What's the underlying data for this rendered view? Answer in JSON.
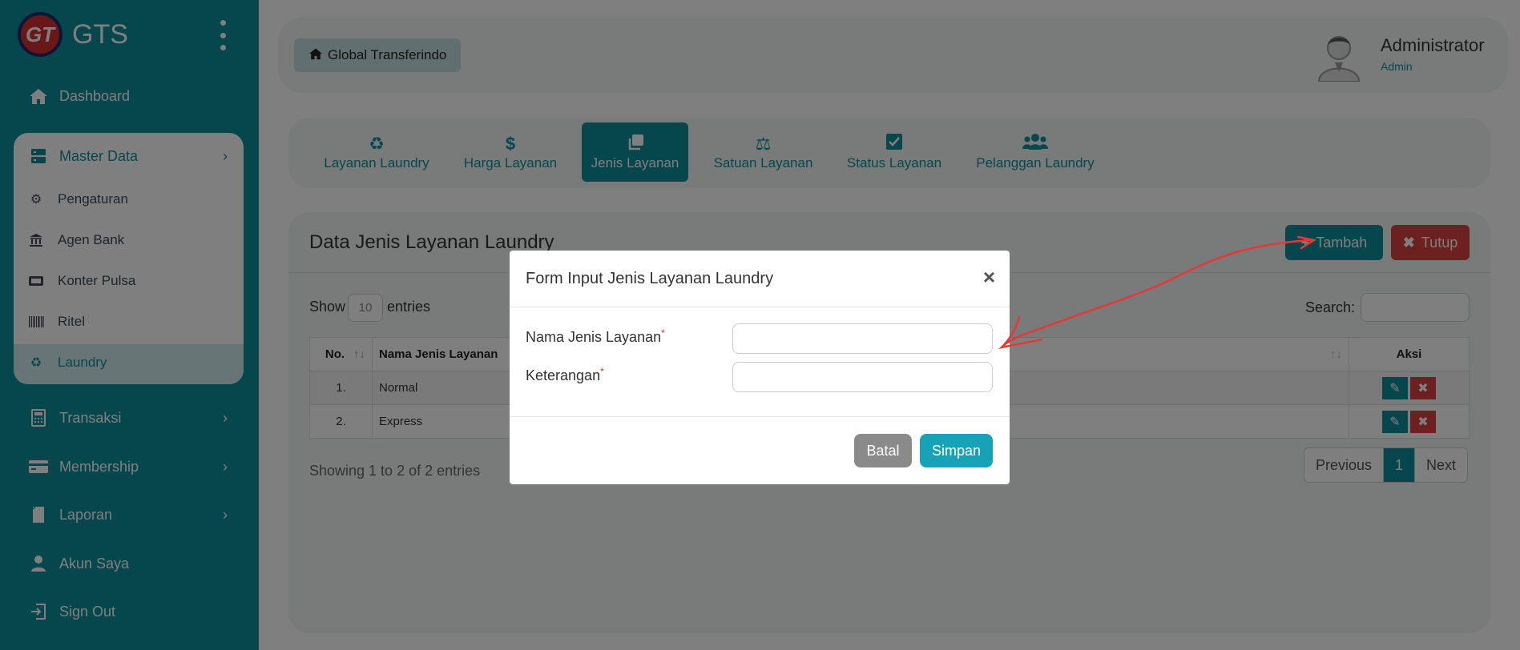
{
  "brand": {
    "logo_text": "GT",
    "name": "GTS"
  },
  "sidebar": {
    "items": [
      {
        "label": "Dashboard",
        "icon": "home-icon"
      },
      {
        "label": "Master Data",
        "icon": "server-icon"
      },
      {
        "label": "Transaksi",
        "icon": "calculator-icon"
      },
      {
        "label": "Membership",
        "icon": "credit-card-icon"
      },
      {
        "label": "Laporan",
        "icon": "book-icon"
      },
      {
        "label": "Akun Saya",
        "icon": "user-icon"
      },
      {
        "label": "Sign Out",
        "icon": "sign-out-icon"
      }
    ],
    "submenu": [
      {
        "label": "Pengaturan",
        "icon": "gear-icon"
      },
      {
        "label": "Agen Bank",
        "icon": "bank-icon"
      },
      {
        "label": "Konter Pulsa",
        "icon": "sim-card-icon"
      },
      {
        "label": "Ritel",
        "icon": "barcode-icon"
      },
      {
        "label": "Laundry",
        "icon": "recycle-icon"
      }
    ]
  },
  "header": {
    "home_label": "Global Transferindo",
    "user_name": "Administrator",
    "user_role": "Admin"
  },
  "tabs": [
    {
      "label": "Layanan Laundry",
      "icon": "recycle-icon"
    },
    {
      "label": "Harga Layanan",
      "icon": "dollar-icon"
    },
    {
      "label": "Jenis Layanan",
      "icon": "clone-icon",
      "active": true
    },
    {
      "label": "Satuan Layanan",
      "icon": "balance-scale-icon"
    },
    {
      "label": "Status Layanan",
      "icon": "check-square-icon"
    },
    {
      "label": "Pelanggan Laundry",
      "icon": "users-icon"
    }
  ],
  "main": {
    "title": "Data Jenis Layanan Laundry",
    "add_label": "Tambah",
    "close_label": "Tutup",
    "show_label": "Show",
    "show_value": "10",
    "entries_label": "entries",
    "search_label": "Search:",
    "columns": [
      "No.",
      "Nama Jenis Layanan",
      "Aksi"
    ],
    "rows": [
      {
        "no": "1.",
        "name": "Normal"
      },
      {
        "no": "2.",
        "name": "Express"
      }
    ],
    "info": "Showing 1 to 2 of 2 entries",
    "pagination": {
      "prev": "Previous",
      "current": "1",
      "next": "Next"
    }
  },
  "modal": {
    "title": "Form Input Jenis Layanan Laundry",
    "close_symbol": "×",
    "field1_label": "Nama Jenis Layanan",
    "field2_label": "Keterangan",
    "required_mark": "*",
    "cancel_label": "Batal",
    "save_label": "Simpan"
  },
  "colors": {
    "accent": "#0d8f9a",
    "danger": "#d9403f",
    "annotation": "#e53935"
  }
}
